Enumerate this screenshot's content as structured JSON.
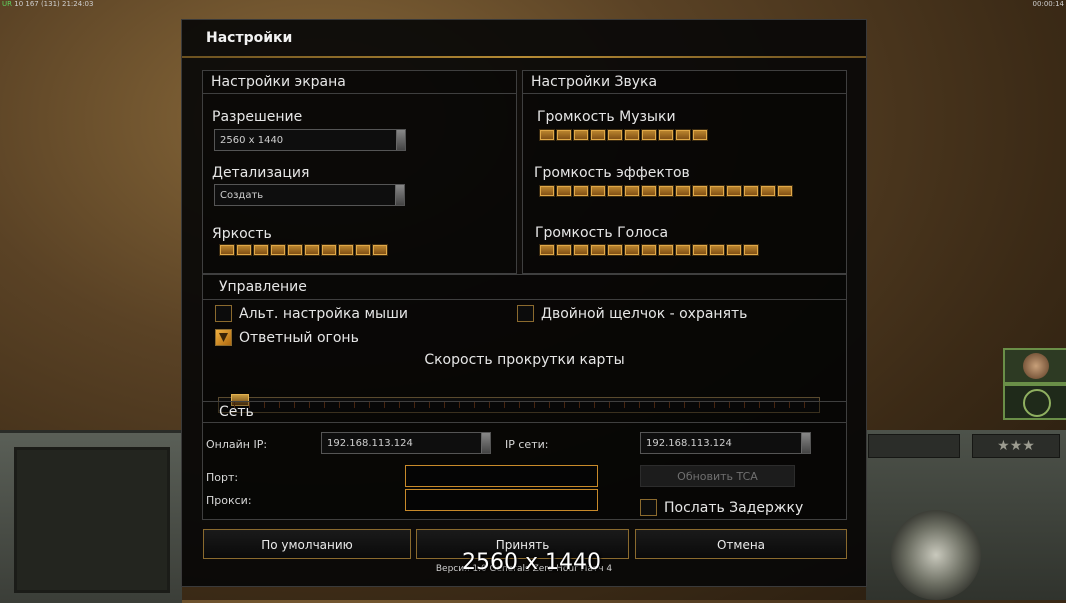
{
  "topbar": {
    "left_prefix": "UR",
    "left_text": "10 167 (131) 21:24:03",
    "right_text": "00:00:14"
  },
  "dialog": {
    "title": "Настройки",
    "screen": {
      "header": "Настройки экрана",
      "resolution_label": "Разрешение",
      "resolution_value": "2560 x 1440",
      "detail_label": "Детализация",
      "detail_value": "Создать",
      "brightness_label": "Яркость",
      "brightness_level": 10,
      "brightness_segments": 10
    },
    "sound": {
      "header": "Настройки Звука",
      "music_label": "Громкость Музыки",
      "music_level": 10,
      "effects_label": "Громкость эффектов",
      "effects_level": 15,
      "voice_label": "Громкость Голоса",
      "voice_level": 13
    },
    "controls": {
      "header": "Управление",
      "alt_mouse_label": "Альт. настройка мыши",
      "alt_mouse_checked": false,
      "double_click_label": "Двойной щелчок - охранять",
      "double_click_checked": false,
      "return_fire_label": "Ответный огонь",
      "return_fire_checked": true,
      "scroll_speed_label": "Скорость прокрутки карты",
      "scroll_speed_value": 0.02
    },
    "network": {
      "header": "Сеть",
      "online_ip_label": "Онлайн IP:",
      "online_ip_value": "192.168.113.124",
      "network_ip_label": "IP сети:",
      "network_ip_value": "192.168.113.124",
      "port_label": "Порт:",
      "proxy_label": "Прокси:",
      "refresh_tca_label": "Обновить TCA",
      "send_delay_label": "Послать Задержку",
      "send_delay_checked": false
    },
    "buttons": {
      "default": "По умолчанию",
      "accept": "Принять",
      "cancel": "Отмена"
    },
    "version": "Версия 1.0 Generals Zero Hour Патч 4"
  },
  "overlay_resolution": "2560 x 1440",
  "colors": {
    "accent": "#c88a2a",
    "segment_on": "#c08a30",
    "panel_border": "#3f3f3f"
  }
}
